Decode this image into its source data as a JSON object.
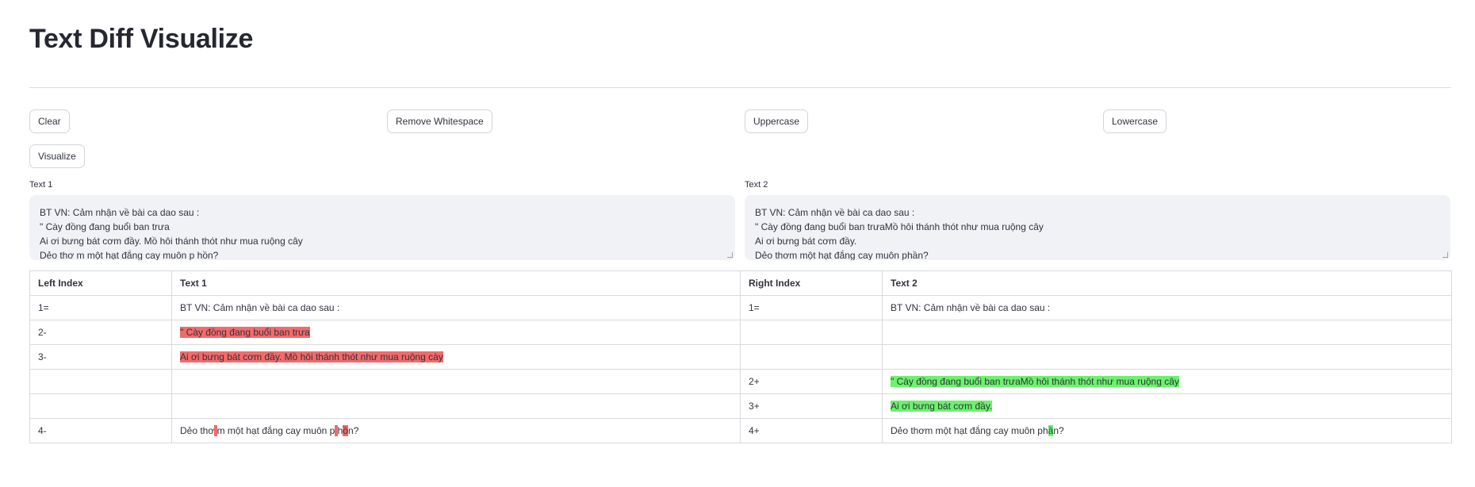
{
  "title": "Text Diff Visualize",
  "buttons": {
    "clear": "Clear",
    "remove_whitespace": "Remove Whitespace",
    "uppercase": "Uppercase",
    "lowercase": "Lowercase",
    "visualize": "Visualize"
  },
  "text1": {
    "label": "Text 1",
    "lines": [
      "BT VN: Cảm nhận về bài ca dao sau :",
      "\" Cày đồng đang buổi ban trưa",
      "Ai ơi bưng bát cơm đầy. Mồ hôi thánh thót như mua ruộng cây",
      "Dẻo thơ m một hạt đắng cay muôn p hồn?"
    ]
  },
  "text2": {
    "label": "Text 2",
    "lines": [
      "BT VN: Cảm nhận về bài ca dao sau :",
      "\" Cày đồng đang buổi ban trưaMồ hôi thánh thót như mua ruộng cây",
      "Ai ơi bưng bát cơm đầy.",
      "Dẻo thơm một hạt đắng cay muôn phần?"
    ]
  },
  "table": {
    "headers": [
      "Left Index",
      "Text 1",
      "Right Index",
      "Text 2"
    ],
    "rows": [
      {
        "left_index": "1=",
        "left_text": "BT VN: Cảm nhận về bài ca dao sau :",
        "right_index": "1=",
        "right_text": "BT VN: Cảm nhận về bài ca dao sau :"
      },
      {
        "left_index": "2-",
        "left_text": "\" Cày đồng đang buổi ban trưa",
        "right_index": "",
        "right_text": ""
      },
      {
        "left_index": "3-",
        "left_text": "Ai ơi bưng bát cơm đầy. Mồ hôi thánh thót như mua ruộng cày",
        "right_index": "",
        "right_text": ""
      },
      {
        "left_index": "",
        "left_text": "",
        "right_index": "2+",
        "right_text": "\" Cày đồng đang buổi ban trưaMồ hôi thánh thót như mua ruộng cây"
      },
      {
        "left_index": "",
        "left_text": "",
        "right_index": "3+",
        "right_text": "Ai ơi bưng bát cơm đầy."
      },
      {
        "left_index": "4-",
        "left_parts": [
          "Dẻo thơ",
          " ",
          "m một hạt đắng cay muôn p",
          " ",
          "h",
          "ồ",
          "n?"
        ],
        "right_index": "4+",
        "right_parts": [
          "Dẻo thơm một hạt đắng cay muôn ph",
          "ầ",
          "n?"
        ]
      }
    ]
  },
  "colors": {
    "deleted_bg": "#f36a6a",
    "added_bg": "#6cf26c",
    "deleted_index": "#ec4848"
  }
}
